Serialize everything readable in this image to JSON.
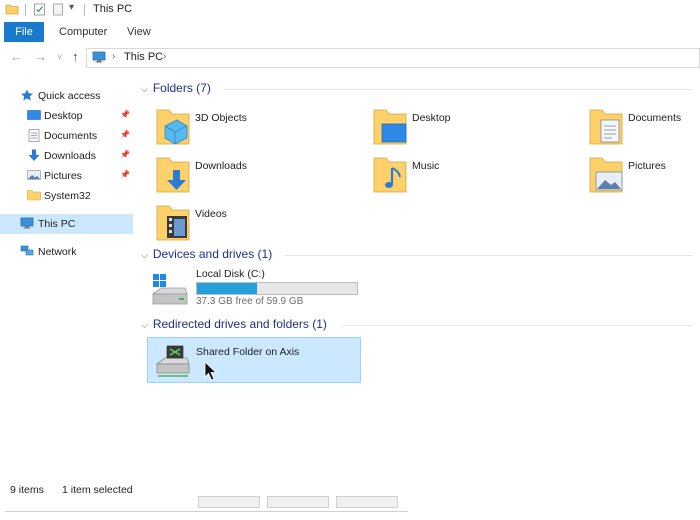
{
  "window": {
    "title": "This PC"
  },
  "ribbon": {
    "file_label": "File",
    "tabs": [
      {
        "label": "Computer"
      },
      {
        "label": "View"
      }
    ]
  },
  "address": {
    "location": "This PC"
  },
  "sidebar": {
    "quick_access": {
      "label": "Quick access"
    },
    "items": [
      {
        "label": "Desktop",
        "pinned": true
      },
      {
        "label": "Documents",
        "pinned": true
      },
      {
        "label": "Downloads",
        "pinned": true
      },
      {
        "label": "Pictures",
        "pinned": true
      },
      {
        "label": "System32",
        "pinned": false
      }
    ],
    "this_pc": {
      "label": "This PC"
    },
    "network": {
      "label": "Network"
    }
  },
  "groups": {
    "folders": {
      "header": "Folders (7)",
      "items": [
        {
          "label": "3D Objects",
          "icon": "3d-objects-folder-icon"
        },
        {
          "label": "Desktop",
          "icon": "desktop-folder-icon"
        },
        {
          "label": "Documents",
          "icon": "documents-folder-icon"
        },
        {
          "label": "Downloads",
          "icon": "downloads-folder-icon"
        },
        {
          "label": "Music",
          "icon": "music-folder-icon"
        },
        {
          "label": "Pictures",
          "icon": "pictures-folder-icon"
        },
        {
          "label": "Videos",
          "icon": "videos-folder-icon"
        }
      ]
    },
    "devices": {
      "header": "Devices and drives (1)",
      "drive": {
        "label": "Local Disk (C:)",
        "free_text": "37.3 GB free of 59.9 GB",
        "used_fraction": 0.377
      }
    },
    "redirected": {
      "header": "Redirected drives and folders (1)",
      "item": {
        "label": "Shared Folder on Axis"
      }
    }
  },
  "status": {
    "items": "9 items",
    "selected": "1 item selected"
  },
  "colors": {
    "accent": "#1979ca",
    "selection": "#cce8ff",
    "drive_fill": "#26a0da",
    "group_header": "#1e3287"
  }
}
